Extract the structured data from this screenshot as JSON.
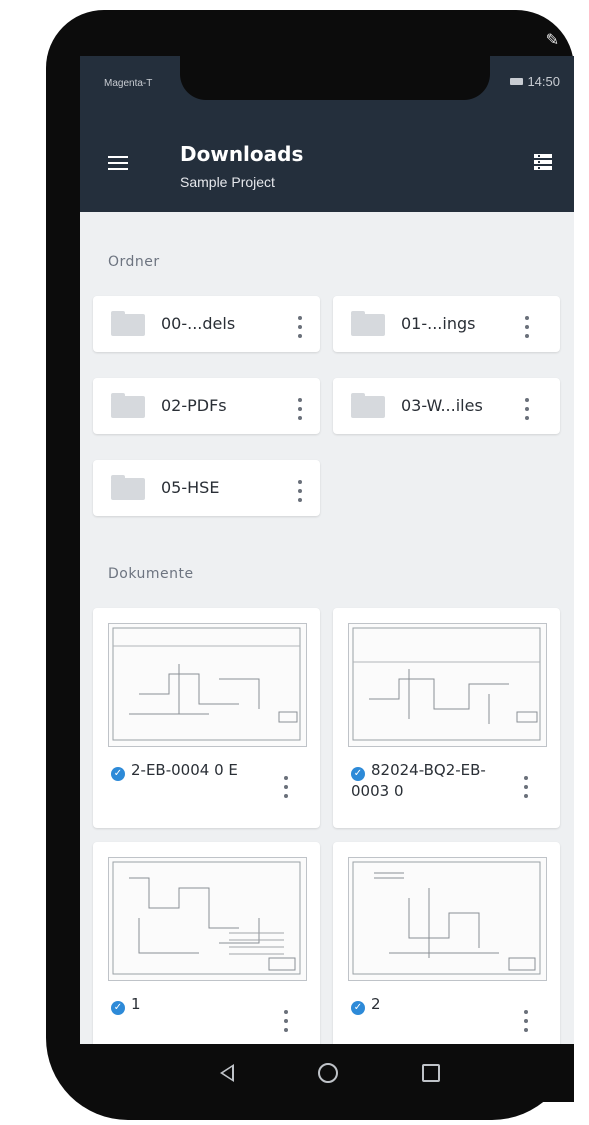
{
  "status_bar": {
    "carrier": "Magenta-T",
    "time": "14:50"
  },
  "app_bar": {
    "title": "Downloads",
    "subtitle": "Sample Project",
    "menu_icon": "hamburger-menu-icon",
    "view_icon": "list-view-icon"
  },
  "folders_section": {
    "label": "Ordner",
    "items": [
      {
        "name": "00-...dels",
        "icon": "folder-icon"
      },
      {
        "name": "01-...ings",
        "icon": "folder-icon"
      },
      {
        "name": "02-PDFs",
        "icon": "folder-icon"
      },
      {
        "name": "03-W...iles",
        "icon": "folder-icon"
      },
      {
        "name": "05-HSE",
        "icon": "folder-icon"
      }
    ]
  },
  "documents_section": {
    "label": "Dokumente",
    "items": [
      {
        "name": "2-EB-0004 0 E",
        "status_icon": "check-circle-icon"
      },
      {
        "name": "82024-BQ2-EB-0003 0",
        "status_icon": "check-circle-icon"
      },
      {
        "name": "1",
        "status_icon": "check-circle-icon"
      },
      {
        "name": "2",
        "status_icon": "check-circle-icon"
      }
    ]
  },
  "nav_bar": {
    "icons": [
      "back-icon",
      "home-icon",
      "recent-apps-icon"
    ]
  },
  "colors": {
    "app_bar": "#242f3c",
    "background": "#eef0f2",
    "check": "#2d8ad8",
    "section_label": "#6d7480"
  }
}
